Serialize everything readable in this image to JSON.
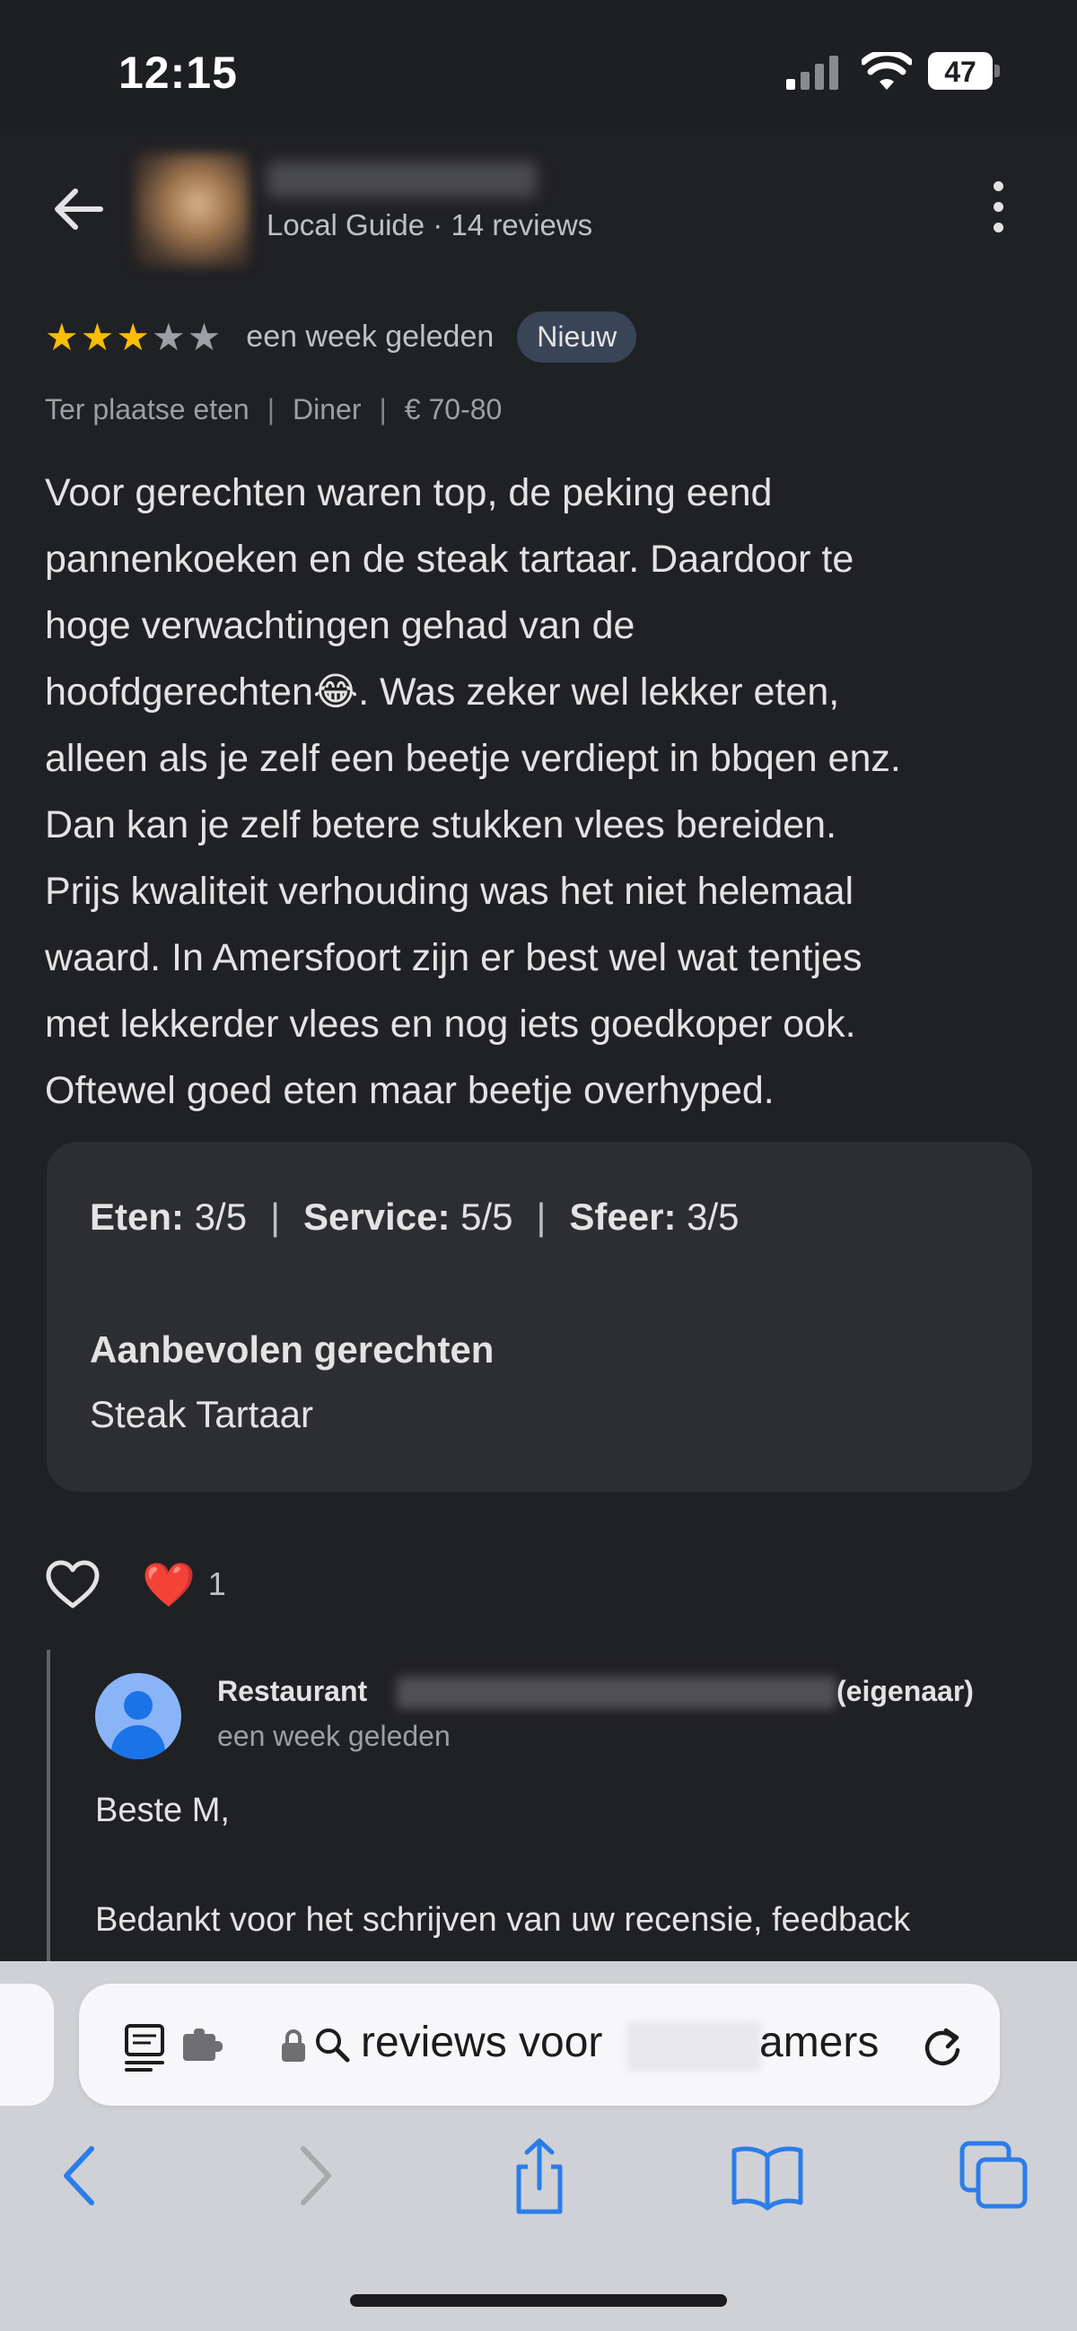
{
  "status_bar": {
    "time": "12:15",
    "battery": "47"
  },
  "header": {
    "subtitle": "Local Guide · 14 reviews"
  },
  "review": {
    "rating": 3,
    "rating_max": 5,
    "ago": "een week geleden",
    "badge": "Nieuw",
    "meta": [
      "Ter plaatse eten",
      "Diner",
      "€ 70-80"
    ],
    "text_lines": [
      "Voor gerechten waren top, de peking eend",
      "pannenkoeken en de steak tartaar. Daardoor te",
      "hoge verwachtingen gehad van de",
      "hoofdgerechten😂. Was zeker wel lekker eten,",
      "alleen als je zelf een beetje verdiept in bbqen enz.",
      "Dan kan je zelf betere stukken vlees bereiden.",
      "Prijs kwaliteit verhouding was het niet helemaal",
      "waard. In Amersfoort zijn er best wel wat tentjes",
      "met lekkerder vlees en nog iets goedkoper ook.",
      "Oftewel goed eten maar beetje overhyped."
    ]
  },
  "details": {
    "eten_label": "Eten:",
    "eten_value": "3/5",
    "service_label": "Service:",
    "service_value": "5/5",
    "sfeer_label": "Sfeer:",
    "sfeer_value": "3/5",
    "recommended_title": "Aanbevolen gerechten",
    "recommended_value": "Steak Tartaar"
  },
  "reactions": {
    "emoji": "❤️",
    "count": "1"
  },
  "owner_reply": {
    "name_prefix": "Restaurant ",
    "role": "(eigenaar)",
    "ago": "een week geleden",
    "greeting": "Beste M,",
    "body": "Bedankt voor het schrijven van uw recensie, feedback"
  },
  "browser": {
    "url_part1": "reviews voor",
    "url_part2": "amers"
  },
  "colors": {
    "star": "#fbbc04",
    "badge_bg": "#394457",
    "accent": "#1a73e8"
  }
}
